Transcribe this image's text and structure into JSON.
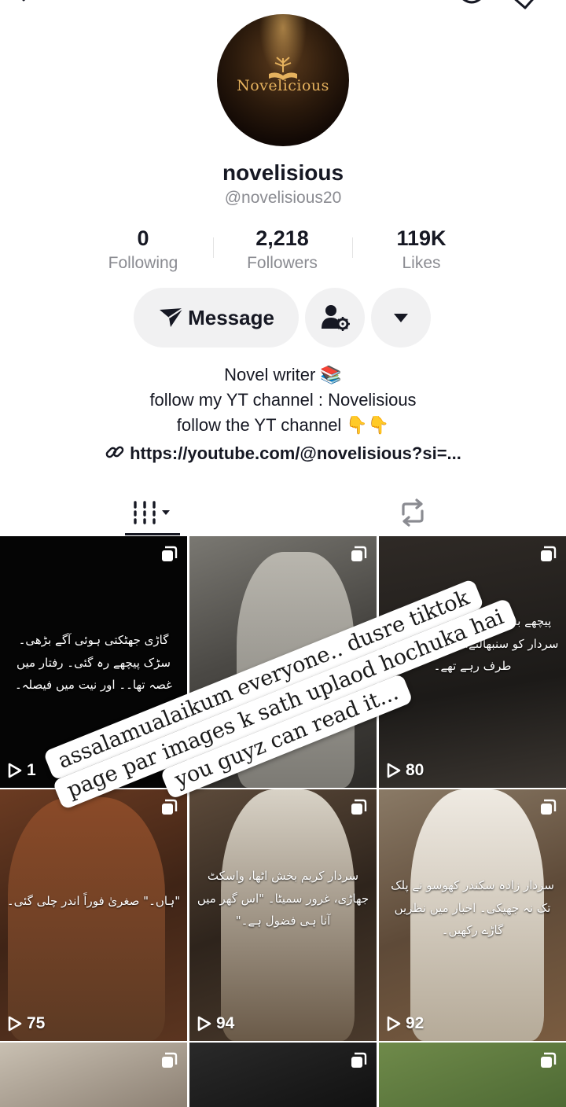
{
  "profile": {
    "display_name": "novelisious",
    "handle": "@novelisious20",
    "avatar_logo_text": "Novelicious"
  },
  "stats": {
    "following_count": "0",
    "following_label": "Following",
    "followers_count": "2,218",
    "followers_label": "Followers",
    "likes_count": "119K",
    "likes_label": "Likes"
  },
  "actions": {
    "message_label": "Message"
  },
  "bio": {
    "line1": "Novel writer 📚",
    "line2": "follow my YT channel : Novelisious",
    "line3": "follow the YT channel 👇👇",
    "link": "https://youtube.com/@novelisious?si=..."
  },
  "overlay_sticker": {
    "line1": "assalamualaikum everyone.. dusre tiktok",
    "line2": "page par images k sath uplaod hochuka hai",
    "line3": "you guyz can read it..."
  },
  "videos": [
    {
      "plays": "1",
      "caption": "گاڑی جھٹکتی ہوئی آگے بڑھی۔ سڑک پیچھے رہ گئی۔ رفتار میں غصہ تھا۔۔ اور نیت میں فیصلہ۔"
    },
    {
      "plays": "",
      "caption": ""
    },
    {
      "plays": "80",
      "caption": "پیچھے بشیر اور سردار کا سپاہی سردار کو سنبھالتے، اٹھاتے کمرے کی طرف رہے تھے۔"
    },
    {
      "plays": "75",
      "caption": "\"ہاں۔\" صغریٰ فوراً اندر چلی گئی۔"
    },
    {
      "plays": "94",
      "caption": "سردار کریم بخش اٹھا، واسکٹ جھاڑی، غرور سمیٹا۔ \"اس گھر میں آنا ہی فضول ہے۔\""
    },
    {
      "plays": "92",
      "caption": "سردار زادہ سکندر کھوسو نے پلک تک نہ جھپکی۔ اخبار میں نظریں گاڑے رکھیں۔"
    },
    {
      "plays": "",
      "caption": ""
    },
    {
      "plays": "",
      "caption": ""
    },
    {
      "plays": "",
      "caption": ""
    }
  ],
  "colors": {
    "text_primary": "#161823",
    "text_secondary": "#8a8b91",
    "button_bg": "#f1f1f2"
  }
}
